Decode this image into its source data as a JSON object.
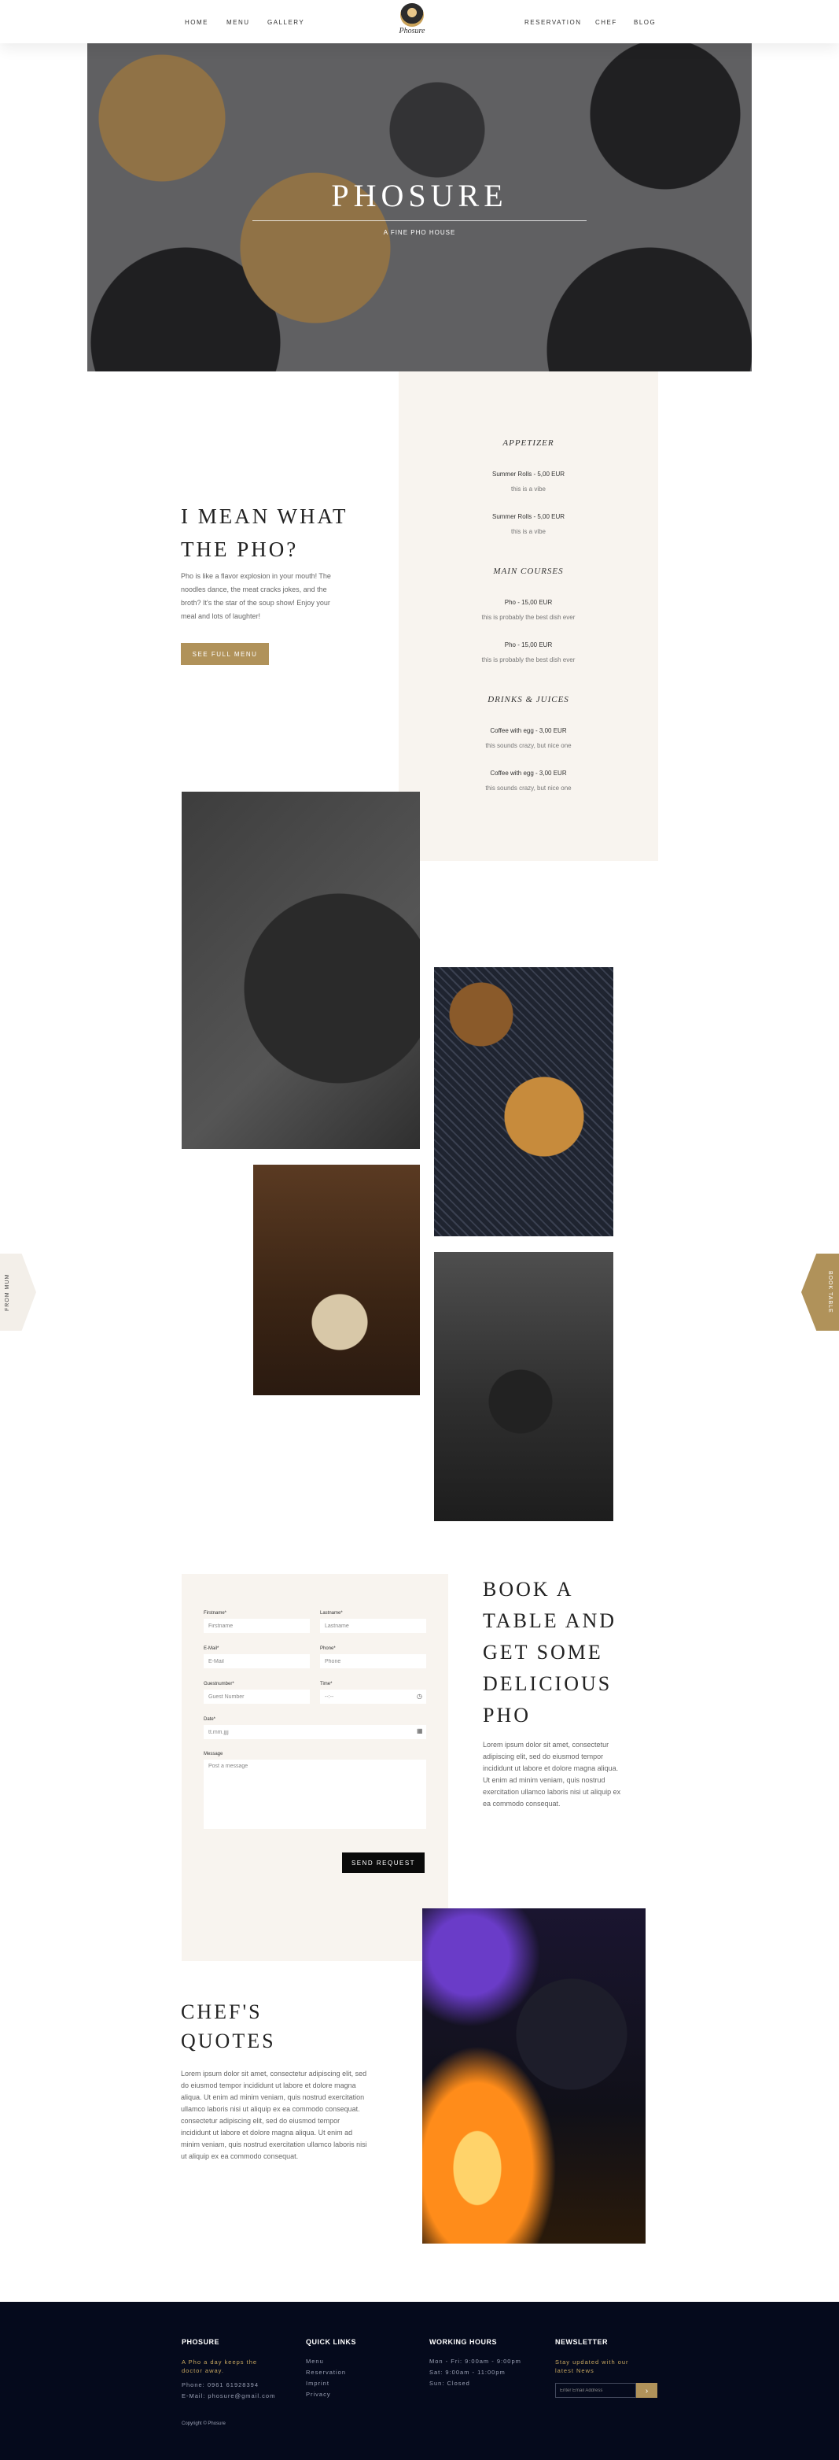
{
  "nav": {
    "left": [
      "HOME",
      "MENU",
      "GALLERY"
    ],
    "right": [
      "RESERVATION",
      "CHEF",
      "BLOG"
    ],
    "logo_text": "Phosure"
  },
  "hero": {
    "title": "PHOSURE",
    "subtitle": "A FINE PHO HOUSE"
  },
  "intro": {
    "title": "I MEAN WHAT THE PHO?",
    "text": "Pho is like a flavor explosion in your mouth! The noodles dance, the meat cracks jokes, and the broth? It's the star of the soup show! Enjoy your meal and lots of laughter!",
    "button": "SEE FULL MENU"
  },
  "menu": {
    "sections": [
      {
        "title": "APPETIZER",
        "items": [
          {
            "name": "Summer Rolls - 5,00 EUR",
            "desc": "this is a vibe"
          },
          {
            "name": "Summer Rolls - 5,00 EUR",
            "desc": "this is a vibe"
          }
        ]
      },
      {
        "title": "MAIN COURSES",
        "items": [
          {
            "name": "Pho - 15,00 EUR",
            "desc": "this is probably the best dish ever"
          },
          {
            "name": "Pho - 15,00 EUR",
            "desc": "this is probably the best dish ever"
          }
        ]
      },
      {
        "title": "DRINKS & JUICES",
        "items": [
          {
            "name": "Coffee with egg - 3,00 EUR",
            "desc": "this sounds crazy, but nice one"
          },
          {
            "name": "Coffee with egg - 3,00 EUR",
            "desc": "this sounds crazy, but nice one"
          }
        ]
      }
    ]
  },
  "side_tabs": {
    "left": "FROM MUM",
    "right": "BOOK TABLE"
  },
  "booking": {
    "title": "BOOK A TABLE AND GET SOME DELICIOUS PHO",
    "text": "Lorem ipsum dolor sit amet, consectetur adipiscing elit, sed do eiusmod tempor incididunt ut labore et dolore magna aliqua. Ut enim ad minim veniam, quis nostrud exercitation ullamco laboris nisi ut aliquip ex ea commodo consequat.",
    "fields": {
      "firstname": {
        "label": "Firstname*",
        "placeholder": "Firstname"
      },
      "lastname": {
        "label": "Lastname*",
        "placeholder": "Lastname"
      },
      "email": {
        "label": "E-Mail*",
        "placeholder": "E-Mail"
      },
      "phone": {
        "label": "Phone*",
        "placeholder": "Phone"
      },
      "guests": {
        "label": "Guestnumber*",
        "placeholder": "Guest Number"
      },
      "time": {
        "label": "Time*",
        "placeholder": "--:--"
      },
      "date": {
        "label": "Date*",
        "placeholder": "tt.mm.jjjj"
      },
      "message": {
        "label": "Message",
        "placeholder": "Post a message"
      }
    },
    "button": "SEND REQUEST"
  },
  "chef": {
    "title": "CHEF'S QUOTES",
    "text": "Lorem ipsum dolor sit amet, consectetur adipiscing elit, sed do eiusmod tempor incididunt ut labore et dolore magna aliqua. Ut enim ad minim veniam, quis nostrud exercitation ullamco laboris nisi ut aliquip ex ea commodo consequat. consectetur adipiscing elit, sed do eiusmod tempor incididunt ut labore et dolore magna aliqua. Ut enim ad minim veniam, quis nostrud exercitation ullamco laboris nisi ut aliquip ex ea commodo consequat."
  },
  "footer": {
    "phosure": {
      "title": "PHOSURE",
      "tagline": "A Pho a day keeps the doctor away.",
      "phone": "Phone: 0961 61928394",
      "email": "E-Mail: phosure@gmail.com"
    },
    "quicklinks": {
      "title": "QUICK LINKS",
      "links": [
        "Menu",
        "Reservation",
        "Imprint",
        "Privacy"
      ]
    },
    "hours": {
      "title": "WORKING HOURS",
      "lines": [
        "Mon - Fri: 9:00am - 9:00pm",
        "Sat: 9:00am - 11:00pm",
        "Sun: Closed"
      ]
    },
    "newsletter": {
      "title": "NEWSLETTER",
      "text": "Stay updated with our latest News",
      "placeholder": "Enter Email Address",
      "button": "›"
    },
    "copyright": "Copyright © Phosure"
  }
}
